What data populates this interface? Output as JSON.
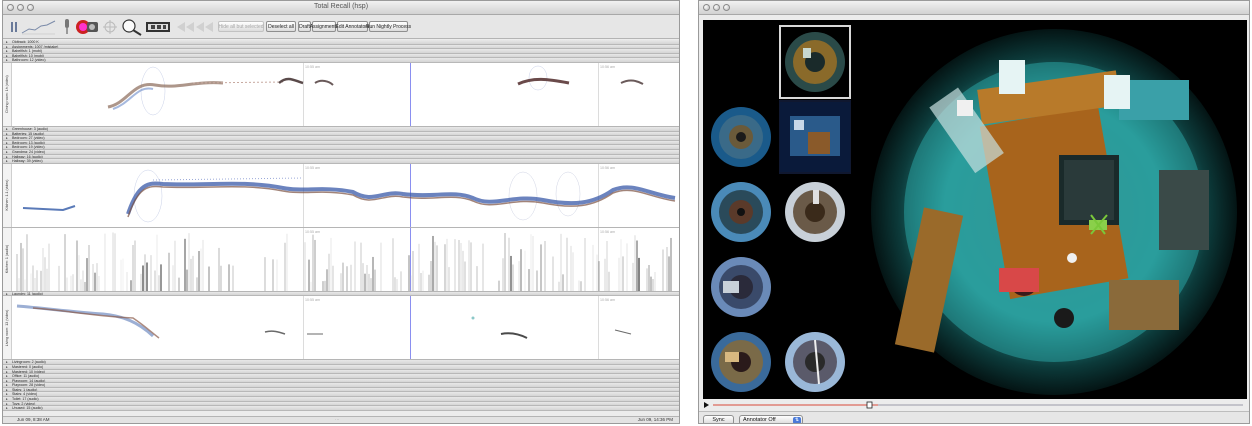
{
  "left_window": {
    "title": "Total Recall (hsp)",
    "toolbar": {
      "hide_all_label": "Hide all but selected",
      "deselect_all_label": "Deselect all",
      "draft_label": "Draft",
      "assignments_label": "Assignments",
      "edit_annotators_label": "Edit Annotators",
      "run_nightly_label": "Run Nightly Process"
    },
    "top_tracks": [
      "Oldtrack: 1000 K",
      "Assignments: 1007 (mistake)",
      "Babelfish: 1 (mobi)",
      "Babelfish: 10 (mobi)",
      "Bathroom: 12 (video)"
    ],
    "panel1_label": "Dining room: 1h (video)",
    "mid_tracks": [
      "Greenhouse: 3 (audio)",
      "Batteries: 15 (audio)",
      "Bedroom: 27 (video)",
      "Bedroom: 13 (audio)",
      "Bedroom: 19 (video)",
      "Grandma: 24 (video)",
      "Hallway: 16 (audio)",
      "Hallway: 39 (video)"
    ],
    "panel2_label": "Kitchen: 1.1 (video)",
    "panel3_label": "Kitchen: 1 (audio)",
    "panel3_header": "Laundry: 11 (audio)",
    "panel4_label": "Living room: 13 (video)",
    "bottom_tracks": [
      "Livingroom: 2 (audio)",
      "Mastered: 0 (audio)",
      "Mastered: 10 (video)",
      "Office: 11 (audio)",
      "Playroom: 14 (audio)",
      "Playroom: 28 (video)",
      "Stairs: 1 (audio)",
      "Stairs: 4 (video)",
      "Toilet: 17 (audio)",
      "Toys: 2 (video)",
      "Unused: 15 (audio)"
    ],
    "time_ticks": [
      "10:55 am",
      "10:55 am",
      "10:56 am"
    ],
    "status_left": "Jun 09, 8:38 AM",
    "status_right": "Jun 09, 14:36 PM"
  },
  "right_window": {
    "sync_label": "Sync",
    "annotator_select": "Annotator Off"
  },
  "colors": {
    "accent": "#8a8ff0",
    "timeline_red": "#d94a3a",
    "video_bg": "#000000"
  },
  "icons": [
    "pause-icon",
    "waveform-icon",
    "microphone-icon",
    "camera-icon",
    "crosshair-icon",
    "zoom-icon",
    "film-icon",
    "skip-icon"
  ]
}
